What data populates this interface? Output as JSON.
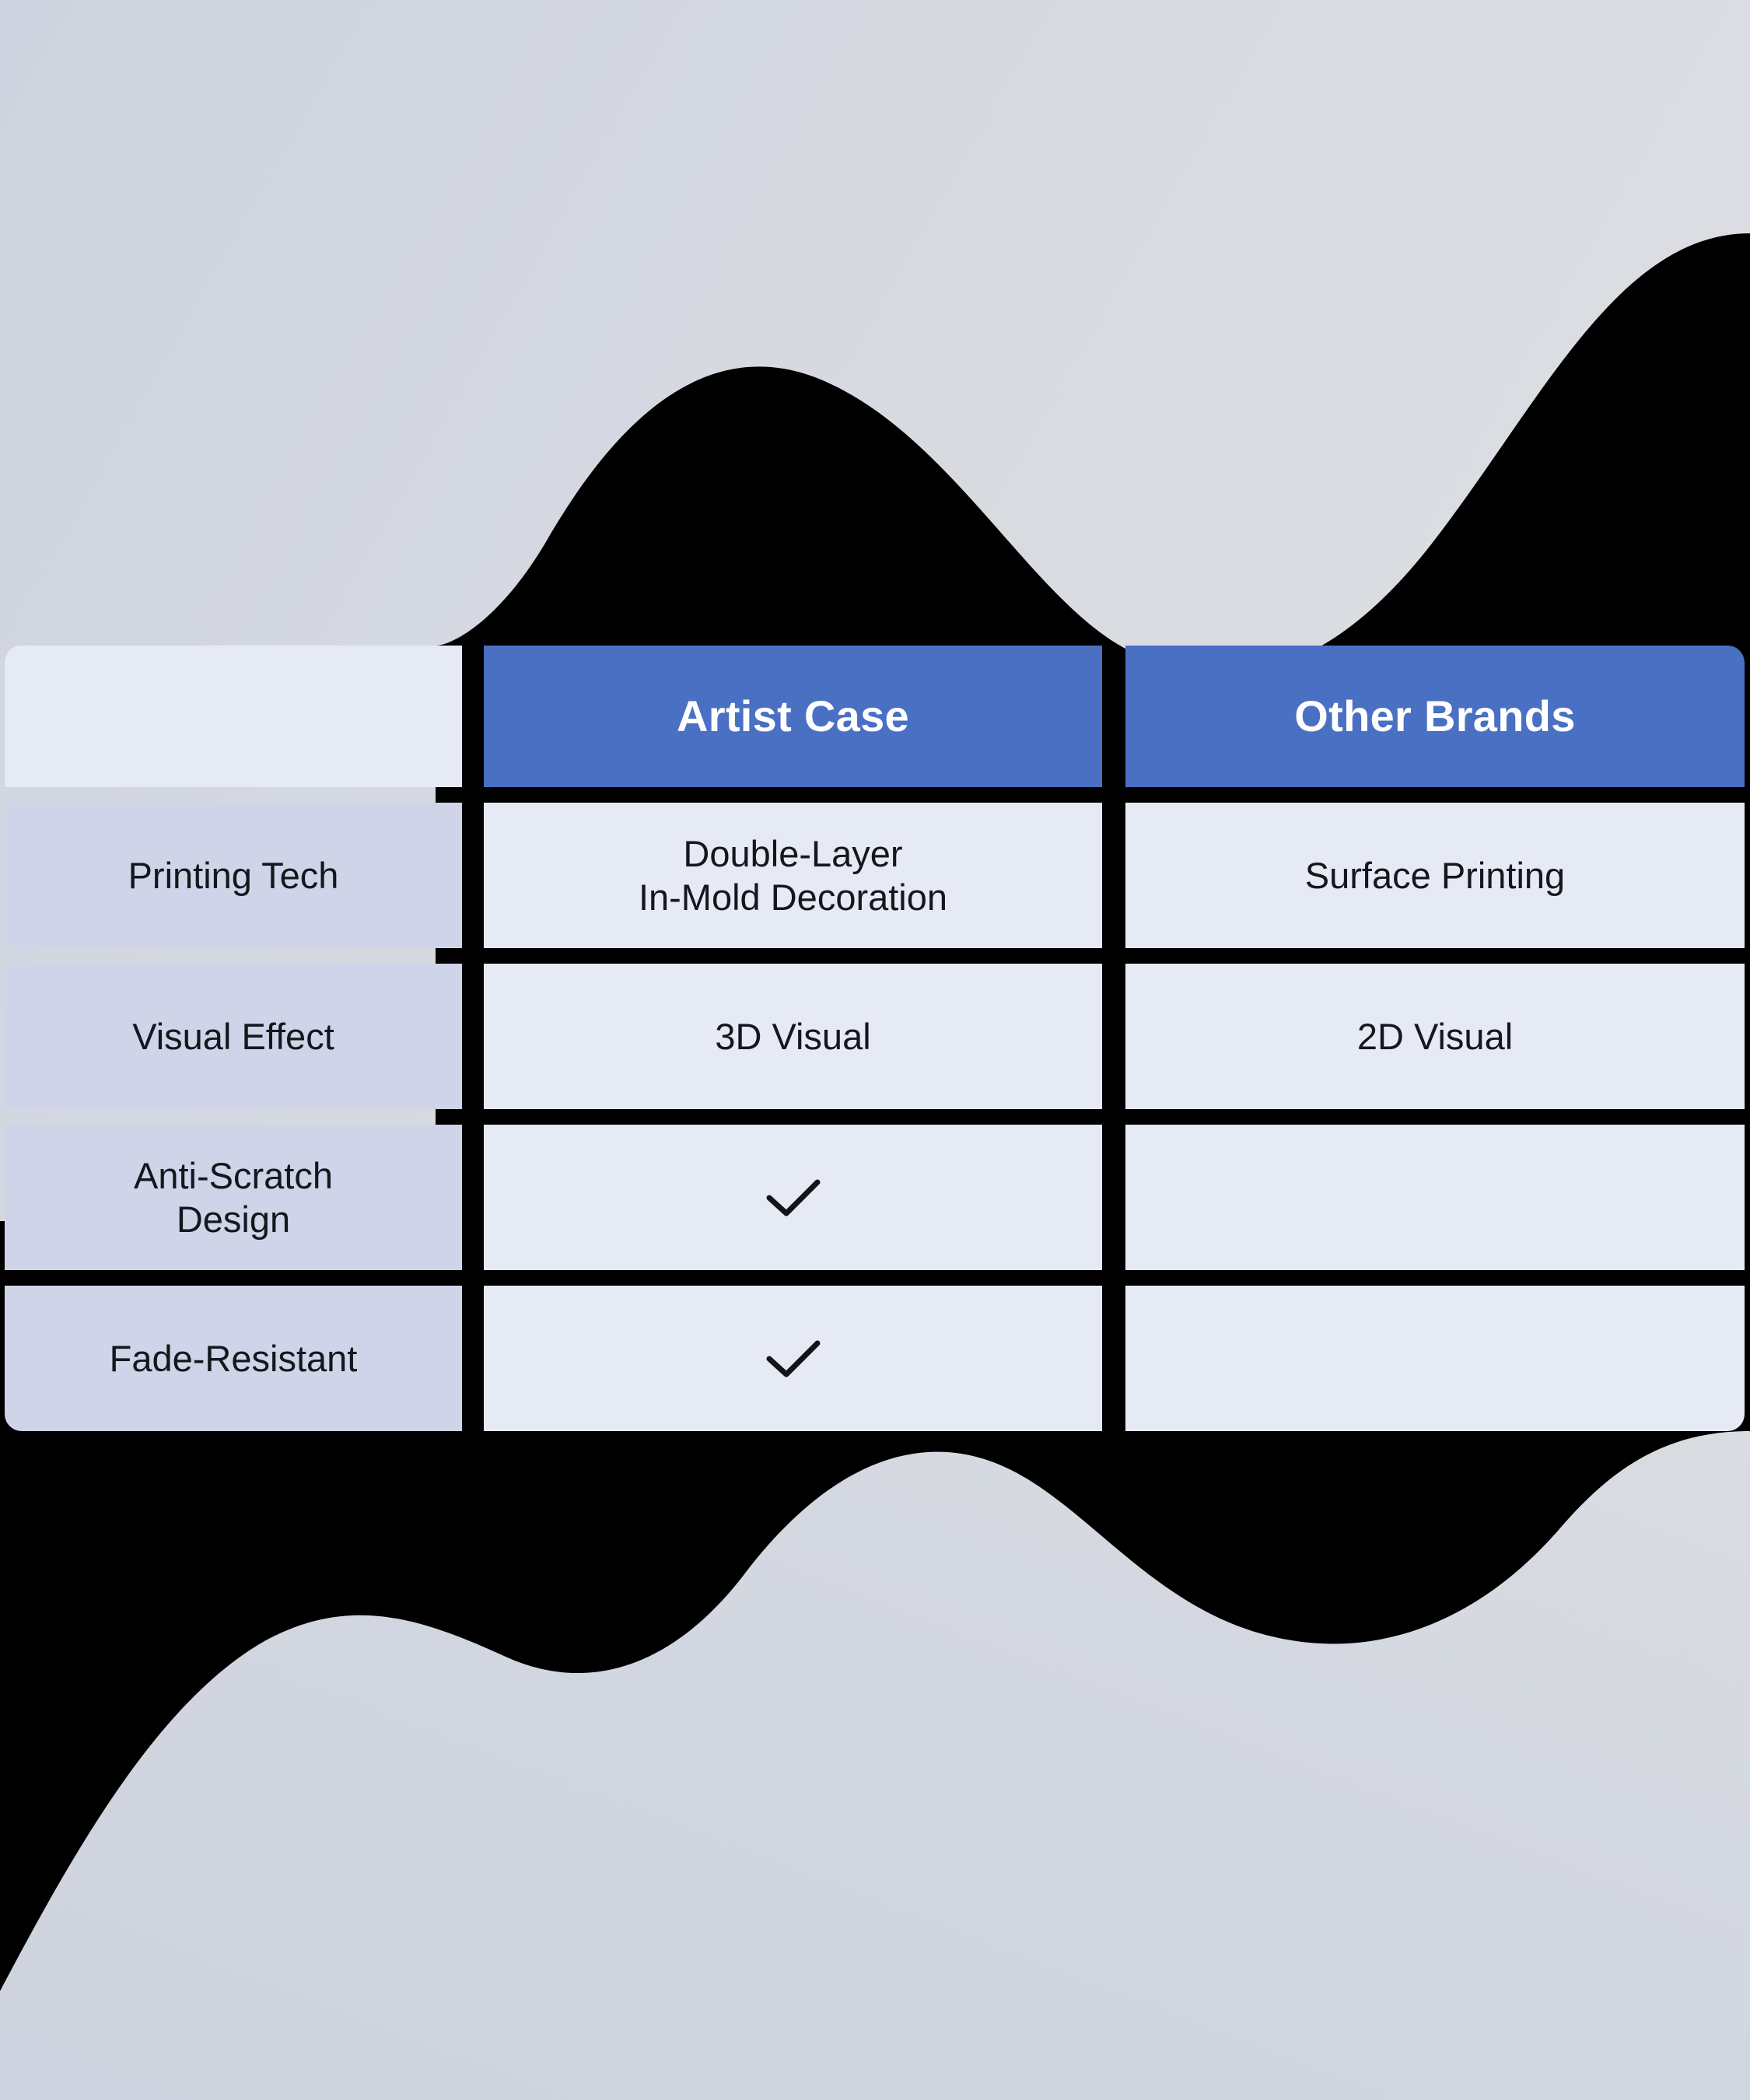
{
  "theme": {
    "page_background": "#000000",
    "header_accent": "#4a70c4",
    "header_text": "#ffffff",
    "label_cell_background": "#cfd4e8",
    "value_cell_background": "#e6eaf4",
    "body_text": "#14171c",
    "wave_light": "#d5d9e3",
    "wave_mid": "#cdd2de",
    "wave_pale": "#dcdfe4"
  },
  "comparison_table": {
    "columns": [
      {
        "key": "feature",
        "label": ""
      },
      {
        "key": "artist_case",
        "label": "Artist Case"
      },
      {
        "key": "other_brands",
        "label": "Other Brands"
      }
    ],
    "rows": [
      {
        "feature": "Printing Tech",
        "artist_case": "Double-Layer\nIn-Mold Decoration",
        "other_brands": "Surface Printing",
        "artist_case_type": "text",
        "other_brands_type": "text"
      },
      {
        "feature": "Visual Effect",
        "artist_case": "3D Visual",
        "other_brands": "2D Visual",
        "artist_case_type": "text",
        "other_brands_type": "text"
      },
      {
        "feature": "Anti-Scratch\nDesign",
        "artist_case": "",
        "other_brands": "",
        "artist_case_type": "check",
        "other_brands_type": "empty"
      },
      {
        "feature": "Fade-Resistant",
        "artist_case": "",
        "other_brands": "",
        "artist_case_type": "check",
        "other_brands_type": "empty"
      }
    ]
  },
  "icons": {
    "check": "check-icon"
  }
}
